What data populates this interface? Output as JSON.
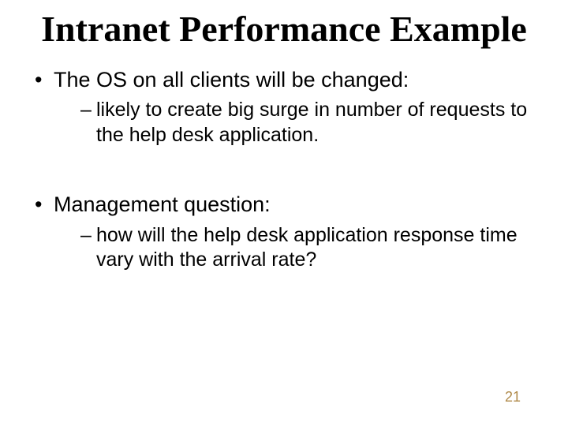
{
  "title": "Intranet Performance Example",
  "bullets": [
    {
      "text": "The OS on all clients will be changed:",
      "sub": [
        " likely to create big surge in number of requests to the help desk application."
      ]
    },
    {
      "text": "Management question:",
      "sub": [
        "how will the help desk application response time vary with the arrival rate?"
      ]
    }
  ],
  "page_number": "21"
}
